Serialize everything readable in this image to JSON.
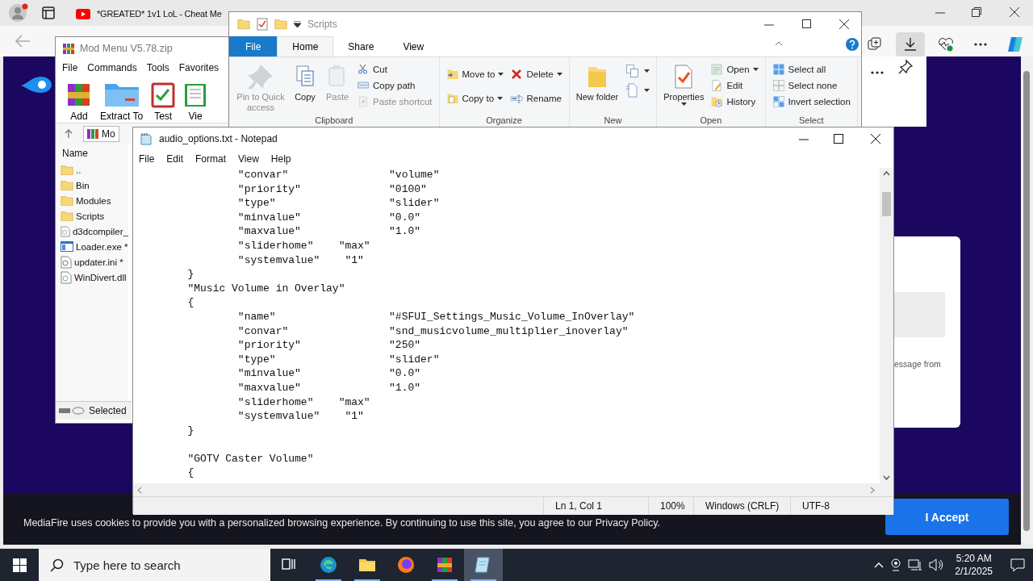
{
  "browser": {
    "tab_title": "*GREATED* 1v1 LoL - Cheat Me",
    "profile_notification": true
  },
  "page": {
    "dialog_text": "essage from",
    "cookie_banner": {
      "text": "MediaFire uses cookies to provide you with a personalized browsing experience. By continuing to use this site, you agree to our Privacy Policy.",
      "button": "I Accept"
    }
  },
  "winrar": {
    "title": "Mod Menu V5.78.zip",
    "menu": [
      "File",
      "Commands",
      "Tools",
      "Favorites"
    ],
    "toolbar": [
      "Add",
      "Extract To",
      "Test",
      "Vie"
    ],
    "path": "Mo",
    "column": "Name",
    "files": [
      {
        "name": "..",
        "kind": "folder"
      },
      {
        "name": "Bin",
        "kind": "folder"
      },
      {
        "name": "Modules",
        "kind": "folder"
      },
      {
        "name": "Scripts",
        "kind": "folder"
      },
      {
        "name": "d3dcompiler_",
        "kind": "dll"
      },
      {
        "name": "Loader.exe *",
        "kind": "exe"
      },
      {
        "name": "updater.ini *",
        "kind": "ini"
      },
      {
        "name": "WinDivert.dll",
        "kind": "dll"
      }
    ],
    "status": "Selected"
  },
  "explorer": {
    "title": "Scripts",
    "tabs": [
      {
        "label": "File",
        "kind": "file",
        "selected": false
      },
      {
        "label": "Home",
        "kind": "tab",
        "selected": true
      },
      {
        "label": "Share",
        "kind": "tab",
        "selected": false
      },
      {
        "label": "View",
        "kind": "tab",
        "selected": false
      }
    ],
    "groups": [
      {
        "label": "Clipboard",
        "items": [
          {
            "label": "Pin to Quick access",
            "kind": "large",
            "disabled": true,
            "dropdown": false
          },
          {
            "label": "Copy",
            "kind": "large",
            "disabled": false,
            "dropdown": false
          },
          {
            "label": "Paste",
            "kind": "large",
            "disabled": true,
            "dropdown": false
          },
          {
            "label": "Cut",
            "kind": "small",
            "disabled": false,
            "dropdown": false
          },
          {
            "label": "Copy path",
            "kind": "small",
            "disabled": false,
            "dropdown": false
          },
          {
            "label": "Paste shortcut",
            "kind": "small",
            "disabled": true,
            "dropdown": false
          }
        ]
      },
      {
        "label": "Organize",
        "items": [
          {
            "label": "Move to",
            "kind": "small",
            "disabled": false,
            "dropdown": true
          },
          {
            "label": "Copy to",
            "kind": "small",
            "disabled": false,
            "dropdown": true
          },
          {
            "label": "Delete",
            "kind": "small",
            "disabled": false,
            "dropdown": true
          },
          {
            "label": "Rename",
            "kind": "small",
            "disabled": false,
            "dropdown": false
          }
        ]
      },
      {
        "label": "New",
        "items": [
          {
            "label": "New folder",
            "kind": "large",
            "disabled": false,
            "dropdown": false
          },
          {
            "kind": "iconmenu",
            "disabled": false,
            "dropdown": true
          },
          {
            "kind": "iconmenu",
            "disabled": false,
            "dropdown": true
          }
        ]
      },
      {
        "label": "Open",
        "items": [
          {
            "label": "Properties",
            "kind": "large",
            "disabled": false,
            "dropdown": true
          },
          {
            "label": "Open",
            "kind": "small",
            "disabled": false,
            "dropdown": true
          },
          {
            "label": "Edit",
            "kind": "small",
            "disabled": false,
            "dropdown": false
          },
          {
            "label": "History",
            "kind": "small",
            "disabled": false,
            "dropdown": false
          }
        ]
      },
      {
        "label": "Select",
        "items": [
          {
            "label": "Select all",
            "kind": "small",
            "disabled": false,
            "dropdown": false
          },
          {
            "label": "Select none",
            "kind": "small",
            "disabled": false,
            "dropdown": false
          },
          {
            "label": "Invert selection",
            "kind": "small",
            "disabled": false,
            "dropdown": false
          }
        ]
      }
    ]
  },
  "notepad": {
    "title": "audio_options.txt - Notepad",
    "menu": [
      "File",
      "Edit",
      "Format",
      "View",
      "Help"
    ],
    "lines": [
      {
        "text": "\t\t\"convar\"\t\t\"volume\""
      },
      {
        "text": "\t\t\"priority\"\t\t\"0100\""
      },
      {
        "text": "\t\t\"type\"\t\t\t\"slider\""
      },
      {
        "text": "\t\t\"minvalue\"\t\t\"0.0\""
      },
      {
        "text": "\t\t\"maxvalue\"\t\t\"1.0\""
      },
      {
        "text": "\t\t\"sliderhome\"\t\"max\""
      },
      {
        "text": "\t\t\"systemvalue\"\t \"1\""
      },
      {
        "text": "\t}"
      },
      {
        "text": "\t\"Music Volume in Overlay\""
      },
      {
        "text": "\t{"
      },
      {
        "text": "\t\t\"name\"\t\t\t\"#SFUI_Settings_Music_Volume_InOverlay\""
      },
      {
        "text": "\t\t\"convar\"\t\t\"snd_musicvolume_multiplier_inoverlay\""
      },
      {
        "text": "\t\t\"priority\"\t\t\"250\""
      },
      {
        "text": "\t\t\"type\"\t\t\t\"slider\""
      },
      {
        "text": "\t\t\"minvalue\"\t\t\"0.0\""
      },
      {
        "text": "\t\t\"maxvalue\"\t\t\"1.0\""
      },
      {
        "text": "\t\t\"sliderhome\"\t\"max\""
      },
      {
        "text": "\t\t\"systemvalue\"\t \"1\""
      },
      {
        "text": "\t}"
      },
      {
        "text": "\t\"GOTV Caster Volume\"",
        "blank_before": true
      },
      {
        "text": "\t{"
      }
    ],
    "status": [
      "Ln 1, Col 1",
      "100%",
      "Windows (CRLF)",
      "UTF-8"
    ]
  },
  "taskbar": {
    "search_placeholder": "Type here to search",
    "apps": [
      {
        "kind": "taskview",
        "running": false,
        "selected": false
      },
      {
        "kind": "edge",
        "running": true,
        "selected": false
      },
      {
        "kind": "explorer",
        "running": true,
        "selected": false
      },
      {
        "kind": "firefox",
        "running": false,
        "selected": false
      },
      {
        "kind": "winrar",
        "running": true,
        "selected": false
      },
      {
        "kind": "notepad",
        "running": true,
        "selected": true
      }
    ],
    "time": "5:20 AM",
    "date": "2/1/2025"
  }
}
